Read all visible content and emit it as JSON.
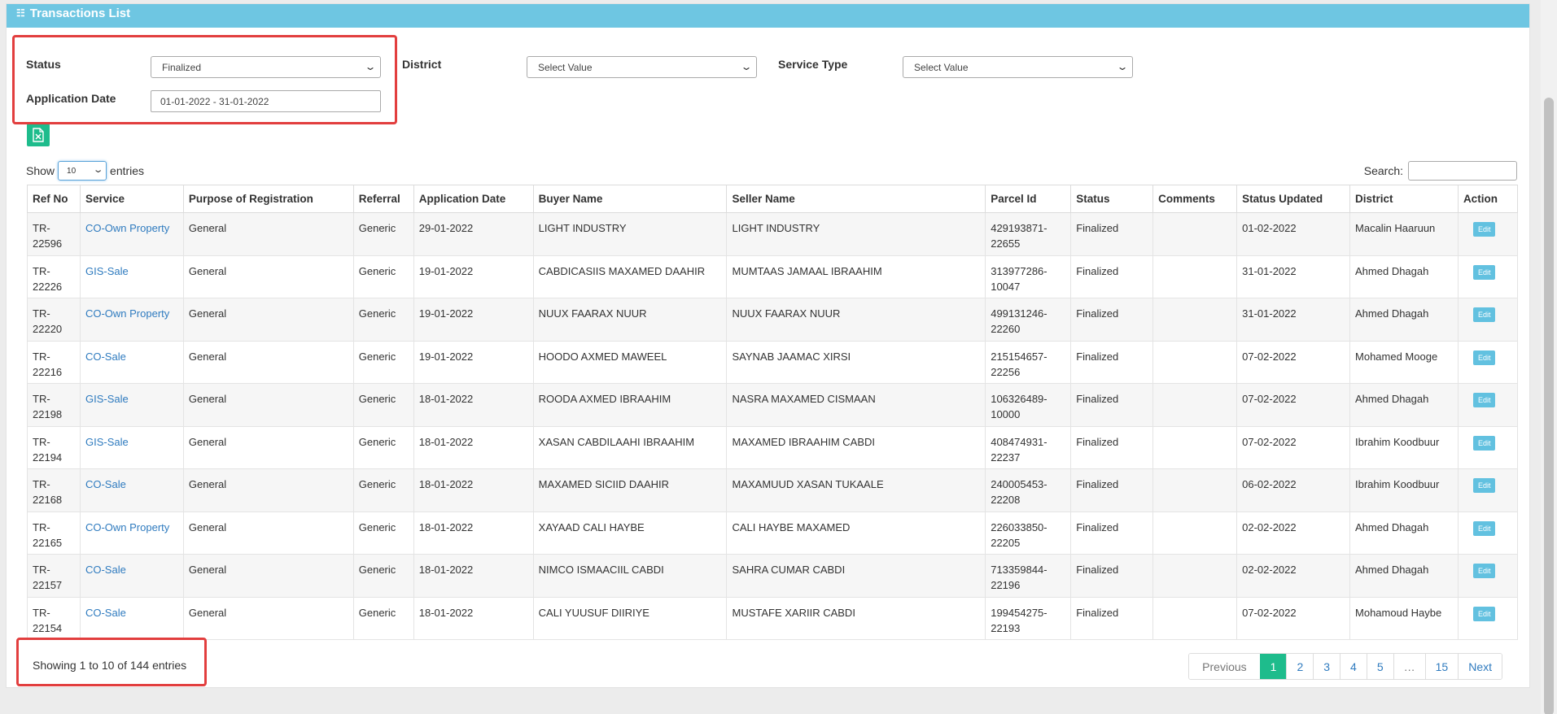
{
  "header": {
    "title": "Transactions List",
    "icon": "list-icon"
  },
  "filters": {
    "status_label": "Status",
    "status_value": "Finalized",
    "date_label": "Application Date",
    "date_value": "01-01-2022 - 31-01-2022",
    "district_label": "District",
    "district_value": "Select Value",
    "service_label": "Service Type",
    "service_value": "Select Value"
  },
  "export": {
    "icon": "excel-icon"
  },
  "length": {
    "show": "Show",
    "value": "10",
    "entries": "entries"
  },
  "search": {
    "label": "Search:"
  },
  "table": {
    "columns": [
      "Ref No",
      "Service",
      "Purpose of Registration",
      "Referral",
      "Application Date",
      "Buyer Name",
      "Seller Name",
      "Parcel Id",
      "Status",
      "Comments",
      "Status Updated",
      "District",
      "Action"
    ],
    "rows": [
      {
        "ref": "TR-22596",
        "service": "CO-Own Property",
        "purpose": "General",
        "referral": "Generic",
        "app_date": "29-01-2022",
        "buyer": "LIGHT INDUSTRY",
        "seller": "LIGHT INDUSTRY",
        "parcel": "429193871-22655",
        "status": "Finalized",
        "comments": "",
        "updated": "01-02-2022",
        "district": "Macalin Haaruun",
        "action": "Edit"
      },
      {
        "ref": "TR-22226",
        "service": "GIS-Sale",
        "purpose": "General",
        "referral": "Generic",
        "app_date": "19-01-2022",
        "buyer": "CABDICASIIS MAXAMED DAAHIR",
        "seller": "MUMTAAS JAMAAL IBRAAHIM",
        "parcel": "313977286-10047",
        "status": "Finalized",
        "comments": "",
        "updated": "31-01-2022",
        "district": "Ahmed Dhagah",
        "action": "Edit"
      },
      {
        "ref": "TR-22220",
        "service": "CO-Own Property",
        "purpose": "General",
        "referral": "Generic",
        "app_date": "19-01-2022",
        "buyer": "NUUX FAARAX NUUR",
        "seller": "NUUX FAARAX NUUR",
        "parcel": "499131246-22260",
        "status": "Finalized",
        "comments": "",
        "updated": "31-01-2022",
        "district": "Ahmed Dhagah",
        "action": "Edit"
      },
      {
        "ref": "TR-22216",
        "service": "CO-Sale",
        "purpose": "General",
        "referral": "Generic",
        "app_date": "19-01-2022",
        "buyer": "HOODO AXMED MAWEEL",
        "seller": "SAYNAB JAAMAC XIRSI",
        "parcel": "215154657-22256",
        "status": "Finalized",
        "comments": "",
        "updated": "07-02-2022",
        "district": "Mohamed Mooge",
        "action": "Edit"
      },
      {
        "ref": "TR-22198",
        "service": "GIS-Sale",
        "purpose": "General",
        "referral": "Generic",
        "app_date": "18-01-2022",
        "buyer": "ROODA AXMED IBRAAHIM",
        "seller": "NASRA MAXAMED CISMAAN",
        "parcel": "106326489-10000",
        "status": "Finalized",
        "comments": "",
        "updated": "07-02-2022",
        "district": "Ahmed Dhagah",
        "action": "Edit"
      },
      {
        "ref": "TR-22194",
        "service": "GIS-Sale",
        "purpose": "General",
        "referral": "Generic",
        "app_date": "18-01-2022",
        "buyer": "XASAN CABDILAAHI IBRAAHIM",
        "seller": "MAXAMED IBRAAHIM CABDI",
        "parcel": "408474931-22237",
        "status": "Finalized",
        "comments": "",
        "updated": "07-02-2022",
        "district": "Ibrahim Koodbuur",
        "action": "Edit"
      },
      {
        "ref": "TR-22168",
        "service": "CO-Sale",
        "purpose": "General",
        "referral": "Generic",
        "app_date": "18-01-2022",
        "buyer": "MAXAMED SICIID DAAHIR",
        "seller": "MAXAMUUD XASAN TUKAALE",
        "parcel": "240005453-22208",
        "status": "Finalized",
        "comments": "",
        "updated": "06-02-2022",
        "district": "Ibrahim Koodbuur",
        "action": "Edit"
      },
      {
        "ref": "TR-22165",
        "service": "CO-Own Property",
        "purpose": "General",
        "referral": "Generic",
        "app_date": "18-01-2022",
        "buyer": "XAYAAD CALI HAYBE",
        "seller": "CALI HAYBE MAXAMED",
        "parcel": "226033850-22205",
        "status": "Finalized",
        "comments": "",
        "updated": "02-02-2022",
        "district": "Ahmed Dhagah",
        "action": "Edit"
      },
      {
        "ref": "TR-22157",
        "service": "CO-Sale",
        "purpose": "General",
        "referral": "Generic",
        "app_date": "18-01-2022",
        "buyer": "NIMCO ISMAACIIL CABDI",
        "seller": "SAHRA CUMAR CABDI",
        "parcel": "713359844-22196",
        "status": "Finalized",
        "comments": "",
        "updated": "02-02-2022",
        "district": "Ahmed Dhagah",
        "action": "Edit"
      },
      {
        "ref": "TR-22154",
        "service": "CO-Sale",
        "purpose": "General",
        "referral": "Generic",
        "app_date": "18-01-2022",
        "buyer": "CALI YUUSUF DIIRIYE",
        "seller": "MUSTAFE XARIIR CABDI",
        "parcel": "199454275-22193",
        "status": "Finalized",
        "comments": "",
        "updated": "07-02-2022",
        "district": "Mohamoud Haybe",
        "action": "Edit"
      }
    ]
  },
  "info": "Showing 1 to 10 of 144 entries",
  "pagination": [
    "Previous",
    "1",
    "2",
    "3",
    "4",
    "5",
    "…",
    "15",
    "Next"
  ],
  "colors": {
    "header_bg": "#6ec6e2",
    "accent": "#1ebc8c",
    "link": "#2f7bbf",
    "highlight": "#e23e3e"
  }
}
